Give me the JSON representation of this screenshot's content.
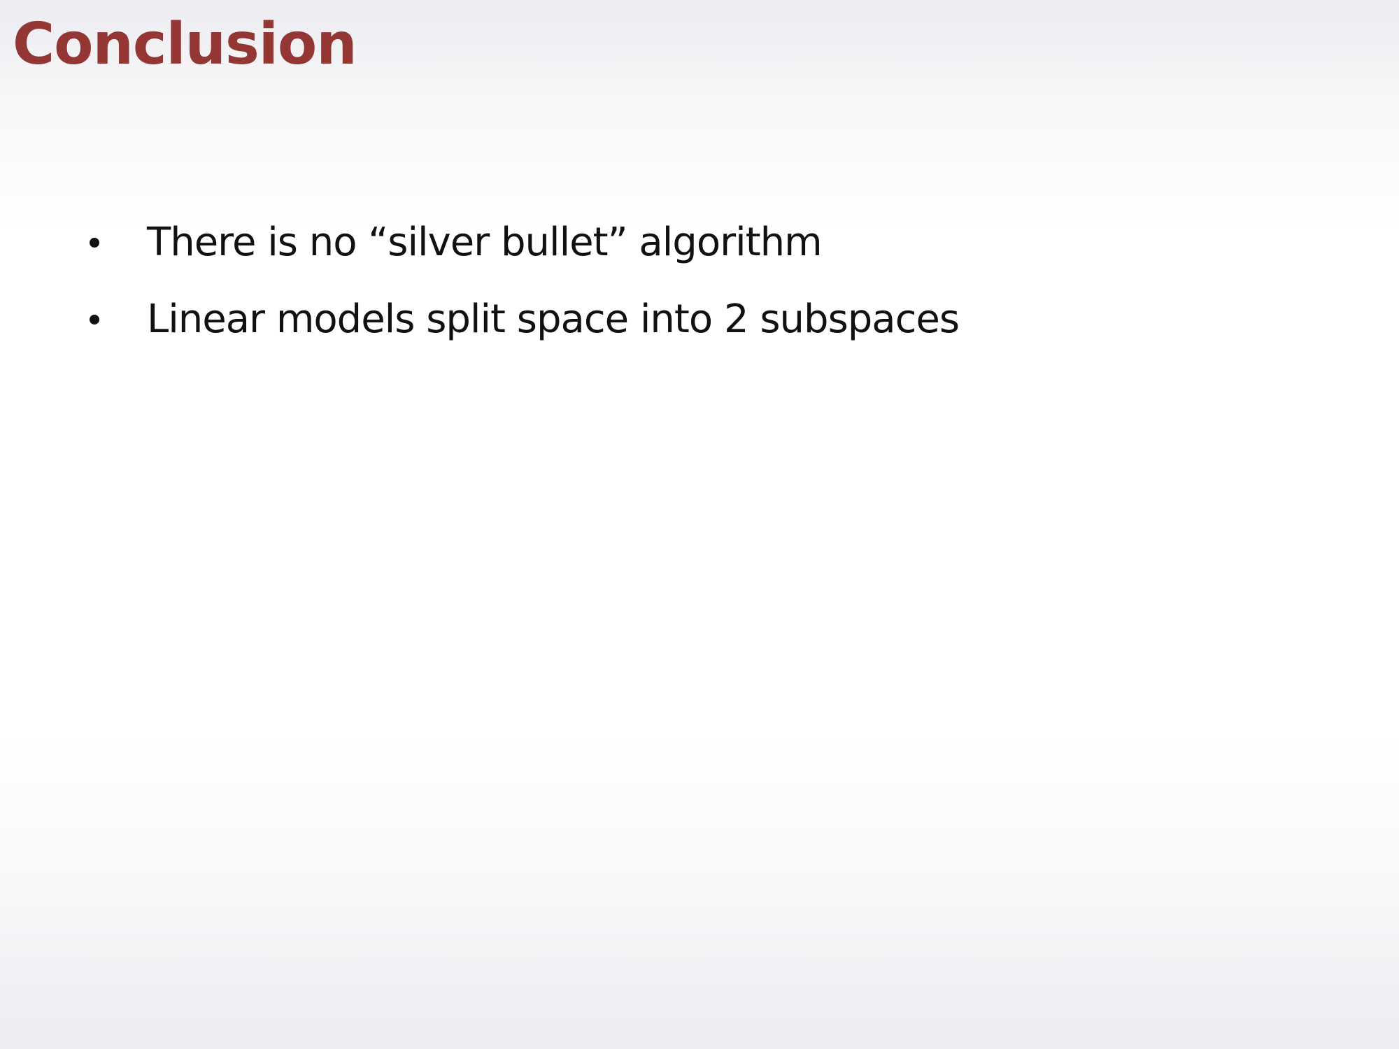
{
  "slide": {
    "title": "Conclusion",
    "title_color": "#943634",
    "text_color": "#111111",
    "bullets": [
      {
        "text": "There is no “silver bullet” algorithm"
      },
      {
        "text": "Linear models split space into 2 subspaces"
      }
    ]
  }
}
